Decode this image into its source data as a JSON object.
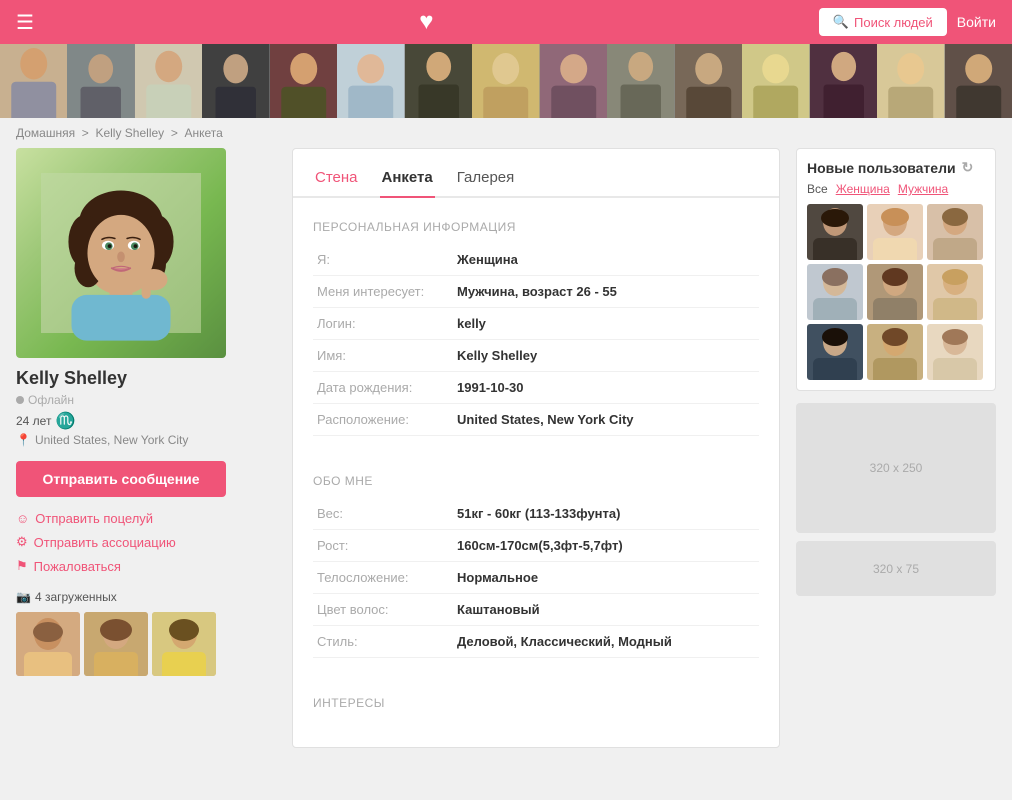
{
  "header": {
    "search_btn": "Поиск людей",
    "login_btn": "Войти",
    "heart": "♥"
  },
  "breadcrumb": {
    "home": "Домашняя",
    "name": "Kelly Shelley",
    "page": "Анкета"
  },
  "profile": {
    "name": "Kelly Shelley",
    "status": "Офлайн",
    "age": "24 лет",
    "zodiac": "♏",
    "location": "United States, New York City",
    "send_message": "Отправить сообщение",
    "action1": "Отправить поцелуй",
    "action2": "Отправить ассоциацию",
    "action3": "Пожаловаться",
    "photos_count": "4 загруженных"
  },
  "tabs": {
    "wall": "Стена",
    "anketa": "Анкета",
    "gallery": "Галерея"
  },
  "personal_info": {
    "title": "ПЕРСОНАЛЬНАЯ ИНФОРМАЦИЯ",
    "rows": [
      {
        "label": "Я:",
        "value": "Женщина"
      },
      {
        "label": "Меня интересует:",
        "value": "Мужчина, возраст 26 - 55"
      },
      {
        "label": "Логин:",
        "value": "kelly"
      },
      {
        "label": "Имя:",
        "value": "Kelly Shelley"
      },
      {
        "label": "Дата рождения:",
        "value": "1991-10-30"
      },
      {
        "label": "Расположение:",
        "value": "United States, New York City"
      }
    ]
  },
  "about_me": {
    "title": "ОБО МНЕ",
    "rows": [
      {
        "label": "Вес:",
        "value": "51кг - 60кг (113-133фунта)"
      },
      {
        "label": "Рост:",
        "value": "160см-170см(5,3фт-5,7фт)"
      },
      {
        "label": "Телосложение:",
        "value": "Нормальное"
      },
      {
        "label": "Цвет волос:",
        "value": "Каштановый"
      },
      {
        "label": "Стиль:",
        "value": "Деловой, Классический, Модный"
      }
    ]
  },
  "interests": {
    "title": "ИНТЕРЕСЫ"
  },
  "right_sidebar": {
    "new_users_title": "Новые пользователи",
    "filter_all": "Все",
    "filter_female": "Женщина",
    "filter_male": "Мужчина",
    "ad_lg": "320 x 250",
    "ad_sm": "320 x 75"
  }
}
